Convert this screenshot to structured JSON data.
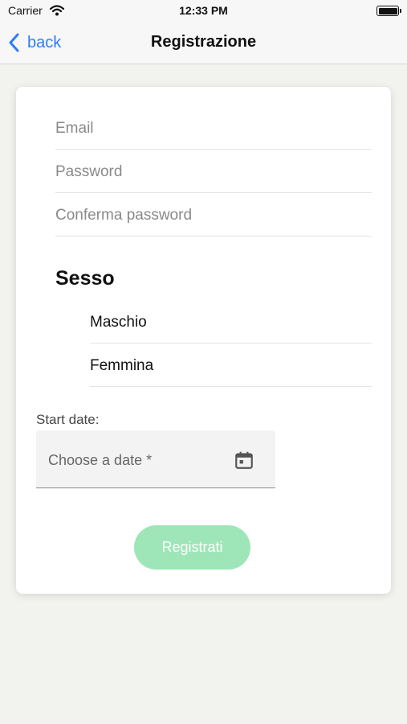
{
  "status_bar": {
    "carrier": "Carrier",
    "time": "12:33 PM"
  },
  "nav": {
    "back_label": "back",
    "title": "Registrazione"
  },
  "form": {
    "email_placeholder": "Email",
    "password_placeholder": "Password",
    "confirm_password_placeholder": "Conferma password",
    "sex_section_title": "Sesso",
    "sex_options": [
      {
        "label": "Maschio"
      },
      {
        "label": "Femmina"
      }
    ],
    "start_date_label": "Start date:",
    "date_placeholder": "Choose a date *",
    "submit_label": "Registrati"
  },
  "colors": {
    "accent": "#2e7cf6",
    "submit_background": "#9ee6b7",
    "page_background": "#f2f2ee"
  },
  "icons": [
    "wifi-icon",
    "battery-icon",
    "back-chevron-icon",
    "calendar-icon"
  ]
}
